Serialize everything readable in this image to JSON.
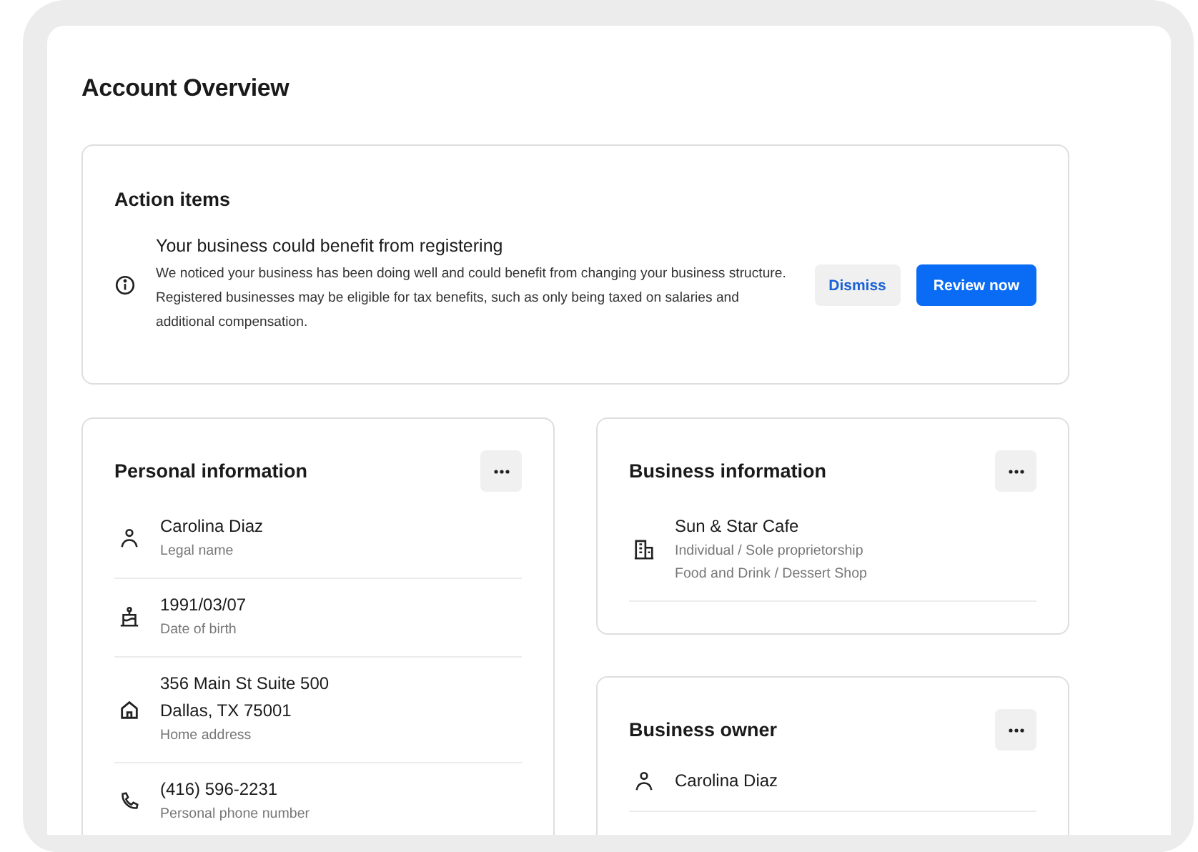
{
  "page_title": "Account Overview",
  "action_items": {
    "title": "Action items",
    "items": [
      {
        "title": "Your business could benefit from registering",
        "body": "We noticed your business has been doing well and could benefit from changing your business structure. Registered businesses may be eligible for tax benefits, such as only being taxed on salaries and additional compensation.",
        "buttons": [
          {
            "label": "Dismiss",
            "kind": "secondary"
          },
          {
            "label": "Review now",
            "kind": "primary"
          }
        ]
      }
    ]
  },
  "personal_information": {
    "title": "Personal information",
    "rows": [
      {
        "kind": "person",
        "lines": [
          "Carolina Diaz"
        ],
        "label": "Legal name"
      },
      {
        "kind": "birthday",
        "lines": [
          "1991/03/07"
        ],
        "label": "Date of birth"
      },
      {
        "kind": "home",
        "lines": [
          "356 Main St Suite 500",
          "Dallas, TX 75001"
        ],
        "label": "Home address"
      },
      {
        "kind": "phone",
        "lines": [
          "(416) 596-2231"
        ],
        "label": "Personal phone number"
      }
    ]
  },
  "business_information": {
    "title": "Business information",
    "rows": [
      {
        "kind": "business",
        "lines": [
          "Sun & Star Cafe"
        ],
        "details": [
          "Individual / Sole proprietorship",
          "Food and Drink / Dessert Shop"
        ]
      }
    ]
  },
  "business_owner": {
    "title": "Business owner",
    "rows": [
      {
        "kind": "person",
        "lines": [
          "Carolina Diaz"
        ]
      }
    ]
  }
}
